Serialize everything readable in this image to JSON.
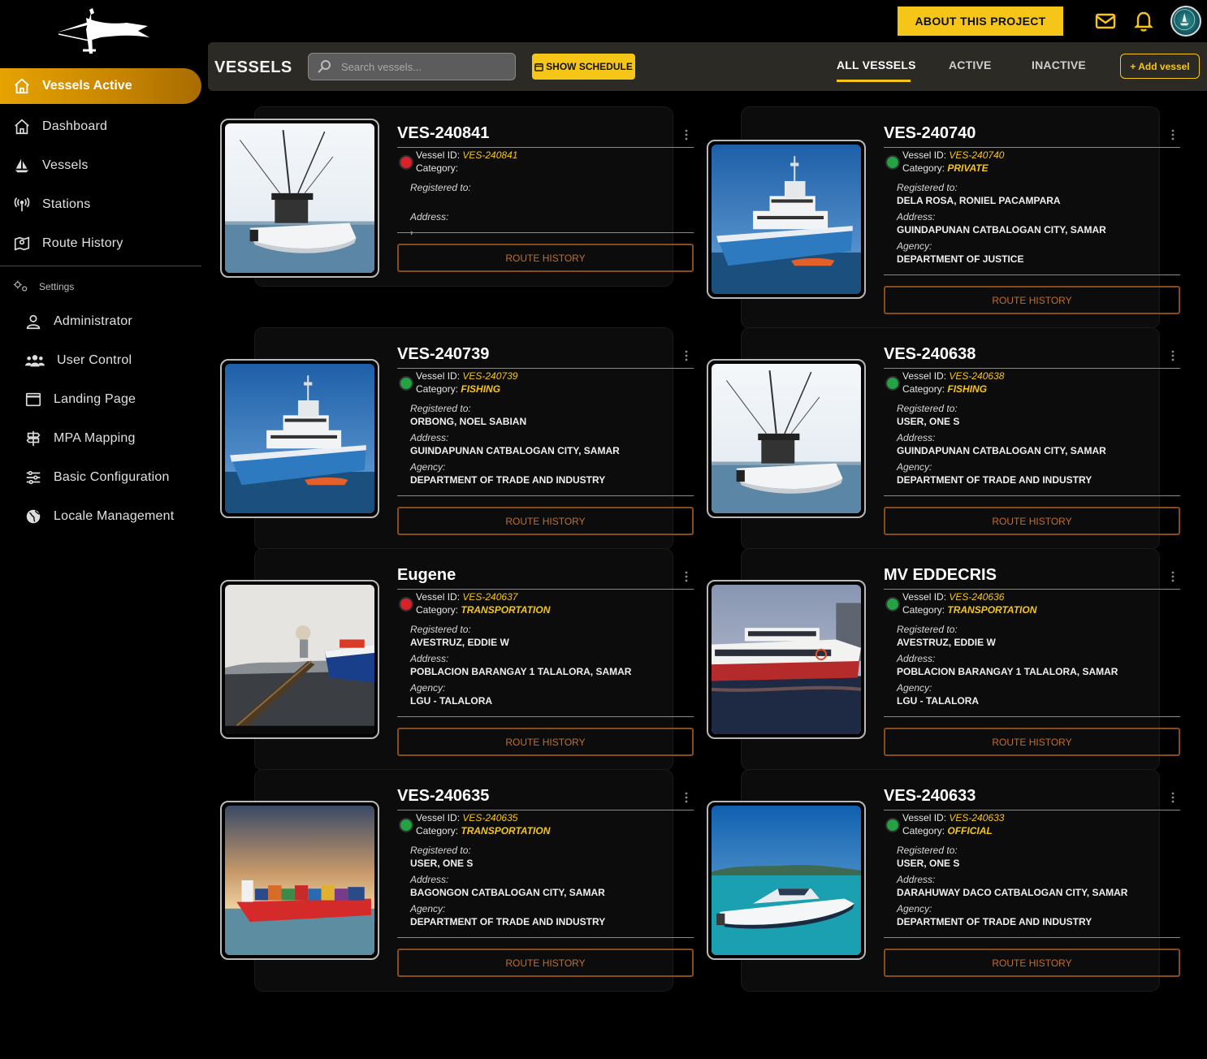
{
  "sidebar": {
    "active_item": {
      "label": "Vessels Active",
      "icon": "home-icon"
    },
    "items": [
      {
        "label": "Dashboard",
        "icon": "home-icon"
      },
      {
        "label": "Vessels",
        "icon": "sailboat-icon"
      },
      {
        "label": "Stations",
        "icon": "antenna-icon"
      },
      {
        "label": "Route History",
        "icon": "map-pin-icon"
      }
    ],
    "settings_label": "Settings",
    "settings_items": [
      {
        "label": "Administrator",
        "icon": "user-icon"
      },
      {
        "label": "User Control",
        "icon": "users-icon"
      },
      {
        "label": "Landing Page",
        "icon": "window-icon"
      },
      {
        "label": "MPA Mapping",
        "icon": "signpost-icon"
      },
      {
        "label": "Basic Configuration",
        "icon": "sliders-icon"
      },
      {
        "label": "Locale Management",
        "icon": "globe-icon"
      }
    ]
  },
  "topbar": {
    "about_label": "ABOUT THIS PROJECT"
  },
  "header": {
    "title": "VESSELS",
    "search_placeholder": "Search vessels...",
    "schedule_label": "SHOW SCHEDULE",
    "tabs": [
      "ALL VESSELS",
      "ACTIVE",
      "INACTIVE"
    ],
    "active_tab": "ALL VESSELS",
    "add_label": "+ Add vessel"
  },
  "labels": {
    "vessel_id": "Vessel ID:",
    "category": "Category:",
    "registered_to": "Registered to:",
    "address": "Address:",
    "agency": "Agency:",
    "route_history": "ROUTE HISTORY"
  },
  "vessels": [
    {
      "name": "VES-240841",
      "id": "VES-240841",
      "category": "",
      "registered_to": "",
      "address": ",",
      "agency": null,
      "status": "inactive",
      "image": "sport-fishing-boat"
    },
    {
      "name": "VES-240740",
      "id": "VES-240740",
      "category": "PRIVATE",
      "registered_to": "DELA ROSA, RONIEL PACAMPARA",
      "address": "GUINDAPUNAN CATBALOGAN CITY, SAMAR",
      "agency": "DEPARTMENT OF JUSTICE",
      "status": "active",
      "image": "research-vessel"
    },
    {
      "name": "VES-240739",
      "id": "VES-240739",
      "category": "FISHING",
      "registered_to": "ORBONG, NOEL SABIAN",
      "address": "GUINDAPUNAN CATBALOGAN CITY, SAMAR",
      "agency": "DEPARTMENT OF TRADE AND INDUSTRY",
      "status": "active",
      "image": "research-vessel"
    },
    {
      "name": "VES-240638",
      "id": "VES-240638",
      "category": "FISHING",
      "registered_to": "USER, ONE S",
      "address": "GUINDAPUNAN CATBALOGAN CITY, SAMAR",
      "agency": "DEPARTMENT OF TRADE AND INDUSTRY",
      "status": "active",
      "image": "sport-fishing-boat"
    },
    {
      "name": "Eugene",
      "id": "VES-240637",
      "category": "TRANSPORTATION",
      "registered_to": "AVESTRUZ, EDDIE W",
      "address": "POBLACION BARANGAY 1 TALALORA, SAMAR",
      "agency": "LGU - TALALORA",
      "status": "inactive",
      "image": "cargo-loading"
    },
    {
      "name": "MV EDDECRIS",
      "id": "VES-240636",
      "category": "TRANSPORTATION",
      "registered_to": "AVESTRUZ, EDDIE W",
      "address": "POBLACION BARANGAY 1 TALALORA, SAMAR",
      "agency": "LGU - TALALORA",
      "status": "active",
      "image": "passenger-ferry"
    },
    {
      "name": "VES-240635",
      "id": "VES-240635",
      "category": "TRANSPORTATION",
      "registered_to": "USER, ONE S",
      "address": "BAGONGON CATBALOGAN CITY, SAMAR",
      "agency": "DEPARTMENT OF TRADE AND INDUSTRY",
      "status": "active",
      "image": "container-ship"
    },
    {
      "name": "VES-240633",
      "id": "VES-240633",
      "category": "OFFICIAL",
      "registered_to": "USER, ONE S",
      "address": "DARAHUWAY DACO CATBALOGAN CITY, SAMAR",
      "agency": "DEPARTMENT OF TRADE AND INDUSTRY",
      "status": "active",
      "image": "speedboat"
    }
  ],
  "colors": {
    "accent": "#f5c518",
    "active_gradient_start": "#e6a300",
    "status_active": "#25a244",
    "status_inactive": "#d8222a",
    "route_button_border": "#8a4b1a",
    "header_bg": "#2b2a24"
  }
}
